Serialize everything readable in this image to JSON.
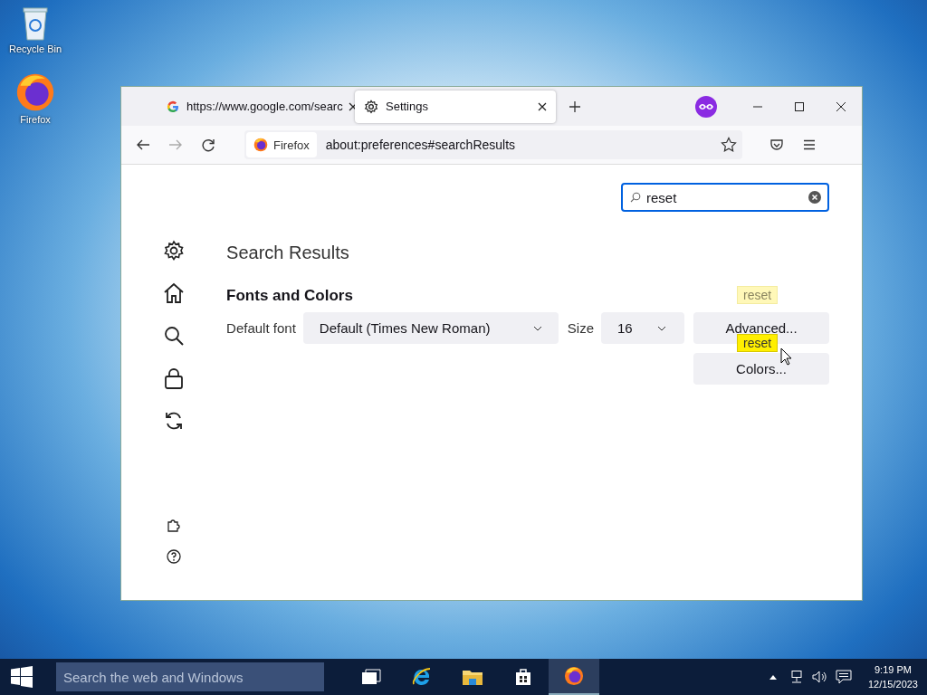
{
  "desktop_icons": [
    {
      "kind": "recycle",
      "label": "Recycle Bin"
    },
    {
      "kind": "firefox",
      "label": "Firefox"
    }
  ],
  "window": {
    "tabs": [
      {
        "kind": "google",
        "label": "https://www.google.com/searc",
        "selected": false
      },
      {
        "kind": "settings",
        "label": "Settings",
        "selected": true
      }
    ],
    "identity": "Firefox",
    "url": "about:preferences#searchResults",
    "search": {
      "value": "reset"
    },
    "sidebar": [
      {
        "kind": "gear"
      },
      {
        "kind": "home"
      },
      {
        "kind": "search"
      },
      {
        "kind": "lock"
      },
      {
        "kind": "sync"
      }
    ],
    "sidebar_bottom": [
      {
        "kind": "puzzle"
      },
      {
        "kind": "help"
      }
    ],
    "heading": "Search Results",
    "section": "Fonts and Colors",
    "font_label": "Default font",
    "font_value": "Default (Times New Roman)",
    "size_label": "Size",
    "size_value": "16",
    "buttons": [
      "Advanced...",
      "Colors..."
    ],
    "highlights": [
      {
        "text": "reset",
        "faded": true
      },
      {
        "text": "reset",
        "faded": false
      }
    ]
  },
  "taskbar": {
    "search_placeholder": "Search the web and Windows",
    "apps": [
      {
        "kind": "taskview",
        "active": false
      },
      {
        "kind": "ie",
        "active": false
      },
      {
        "kind": "folder",
        "active": false
      },
      {
        "kind": "store",
        "active": false
      },
      {
        "kind": "firefox",
        "active": true
      }
    ],
    "time": "9:19 PM",
    "date": "12/15/2023"
  }
}
